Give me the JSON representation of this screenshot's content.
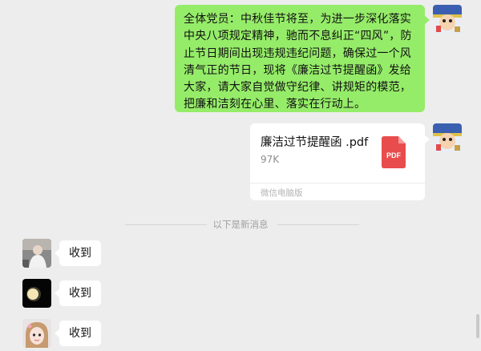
{
  "messages": {
    "outgoing_text": "全体党员：中秋佳节将至，为进一步深化落实中央八项规定精神，驰而不息纠正“四风”，防止节日期间出现违规违纪问题，确保过一个风清气正的节日，现将《廉洁过节提醒函》发给大家，请大家自觉做守纪律、讲规矩的模范，把廉和洁刻在心里、落实在行动上。",
    "file": {
      "name": "廉洁过节提醒函 .pdf",
      "size": "97K",
      "icon_label": "PDF",
      "icon": "pdf-file-icon",
      "footer": "微信电脑版"
    },
    "separator": "以下是新消息",
    "replies": [
      {
        "text": "收到",
        "avatar": "avatar-photo-person"
      },
      {
        "text": "收到",
        "avatar": "avatar-moon"
      },
      {
        "text": "收到",
        "avatar": "avatar-girl"
      }
    ]
  },
  "colors": {
    "background": "#ededed",
    "outgoing_bubble": "#95ec69",
    "incoming_bubble": "#ffffff",
    "pdf_red": "#e94c4c"
  }
}
